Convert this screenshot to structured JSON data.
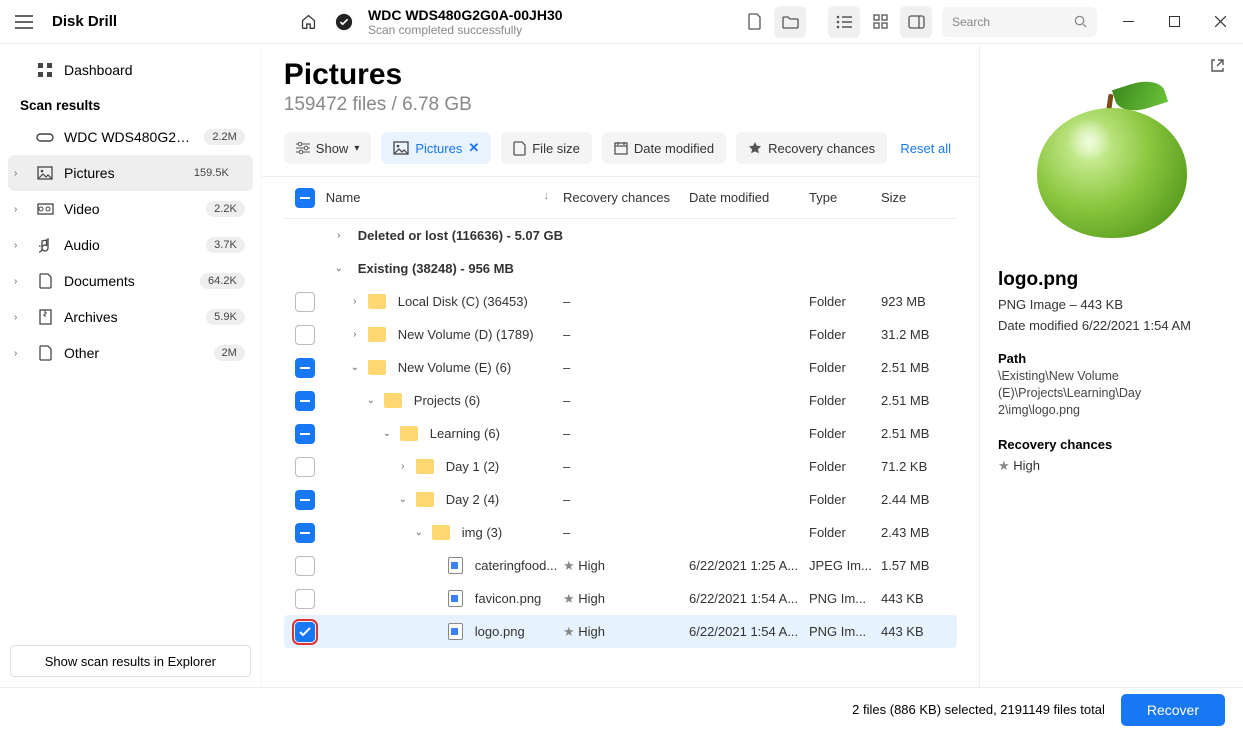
{
  "app_name": "Disk Drill",
  "titlebar": {
    "drive_name": "WDC WDS480G2G0A-00JH30",
    "status": "Scan completed successfully",
    "search_placeholder": "Search"
  },
  "sidebar": {
    "dashboard": "Dashboard",
    "section": "Scan results",
    "drive": {
      "label": "WDC WDS480G2G0A-0...",
      "badge": "2.2M"
    },
    "cats": [
      {
        "label": "Pictures",
        "badge": "159.5K",
        "selected": true,
        "icon": "image-icon"
      },
      {
        "label": "Video",
        "badge": "2.2K",
        "selected": false,
        "icon": "video-icon"
      },
      {
        "label": "Audio",
        "badge": "3.7K",
        "selected": false,
        "icon": "audio-icon"
      },
      {
        "label": "Documents",
        "badge": "64.2K",
        "selected": false,
        "icon": "document-icon"
      },
      {
        "label": "Archives",
        "badge": "5.9K",
        "selected": false,
        "icon": "archive-icon"
      },
      {
        "label": "Other",
        "badge": "2M",
        "selected": false,
        "icon": "other-icon"
      }
    ],
    "footer_button": "Show scan results in Explorer"
  },
  "main": {
    "title": "Pictures",
    "subtitle": "159472 files / 6.78 GB",
    "filter_show": "Show",
    "filters": [
      {
        "label": "Pictures",
        "active": true,
        "icon": "image-icon"
      },
      {
        "label": "File size",
        "active": false,
        "icon": "filesize-icon"
      },
      {
        "label": "Date modified",
        "active": false,
        "icon": "calendar-icon"
      },
      {
        "label": "Recovery chances",
        "active": false,
        "icon": "star-icon"
      }
    ],
    "reset_label": "Reset all",
    "columns": {
      "name": "Name",
      "rc": "Recovery chances",
      "dm": "Date modified",
      "type": "Type",
      "size": "Size"
    },
    "rows": [
      {
        "chk": "none",
        "chev": ">",
        "indent": 0,
        "icon": "",
        "name": "Deleted or lost (116636) - 5.07 GB",
        "rc": "",
        "dm": "",
        "type": "",
        "size": "",
        "bold": true
      },
      {
        "chk": "none",
        "chev": "v",
        "indent": 0,
        "icon": "",
        "name": "Existing (38248) - 956 MB",
        "rc": "",
        "dm": "",
        "type": "",
        "size": "",
        "bold": true
      },
      {
        "chk": "empty",
        "chev": ">",
        "indent": 1,
        "icon": "folder",
        "name": "Local Disk (C) (36453)",
        "rc": "–",
        "dm": "",
        "type": "Folder",
        "size": "923 MB"
      },
      {
        "chk": "empty",
        "chev": ">",
        "indent": 1,
        "icon": "folder",
        "name": "New Volume (D) (1789)",
        "rc": "–",
        "dm": "",
        "type": "Folder",
        "size": "31.2 MB"
      },
      {
        "chk": "part",
        "chev": "v",
        "indent": 1,
        "icon": "folder",
        "name": "New Volume (E) (6)",
        "rc": "–",
        "dm": "",
        "type": "Folder",
        "size": "2.51 MB"
      },
      {
        "chk": "part",
        "chev": "v",
        "indent": 2,
        "icon": "folder",
        "name": "Projects (6)",
        "rc": "–",
        "dm": "",
        "type": "Folder",
        "size": "2.51 MB"
      },
      {
        "chk": "part",
        "chev": "v",
        "indent": 3,
        "icon": "folder",
        "name": "Learning (6)",
        "rc": "–",
        "dm": "",
        "type": "Folder",
        "size": "2.51 MB"
      },
      {
        "chk": "empty",
        "chev": ">",
        "indent": 4,
        "icon": "folder",
        "name": "Day 1 (2)",
        "rc": "–",
        "dm": "",
        "type": "Folder",
        "size": "71.2 KB"
      },
      {
        "chk": "part",
        "chev": "v",
        "indent": 4,
        "icon": "folder",
        "name": "Day 2 (4)",
        "rc": "–",
        "dm": "",
        "type": "Folder",
        "size": "2.44 MB"
      },
      {
        "chk": "part",
        "chev": "v",
        "indent": 5,
        "icon": "folder",
        "name": "img (3)",
        "rc": "–",
        "dm": "",
        "type": "Folder",
        "size": "2.43 MB"
      },
      {
        "chk": "empty",
        "chev": "",
        "indent": 6,
        "icon": "file",
        "name": "cateringfood...",
        "rc": "High",
        "dm": "6/22/2021 1:25 A...",
        "type": "JPEG Im...",
        "size": "1.57 MB"
      },
      {
        "chk": "empty",
        "chev": "",
        "indent": 6,
        "icon": "file",
        "name": "favicon.png",
        "rc": "High",
        "dm": "6/22/2021 1:54 A...",
        "type": "PNG Im...",
        "size": "443 KB"
      },
      {
        "chk": "checked",
        "chev": "",
        "indent": 6,
        "icon": "file",
        "name": "logo.png",
        "rc": "High",
        "dm": "6/22/2021 1:54 A...",
        "type": "PNG Im...",
        "size": "443 KB",
        "sel": true,
        "hl": true
      }
    ]
  },
  "preview": {
    "name": "logo.png",
    "meta": "PNG Image – 443 KB",
    "modified": "Date modified 6/22/2021 1:54 AM",
    "path_label": "Path",
    "path": "\\Existing\\New Volume (E)\\Projects\\Learning\\Day 2\\img\\logo.png",
    "rc_label": "Recovery chances",
    "rc_value": "High"
  },
  "footer": {
    "status": "2 files (886 KB) selected, 2191149 files total",
    "button": "Recover"
  }
}
